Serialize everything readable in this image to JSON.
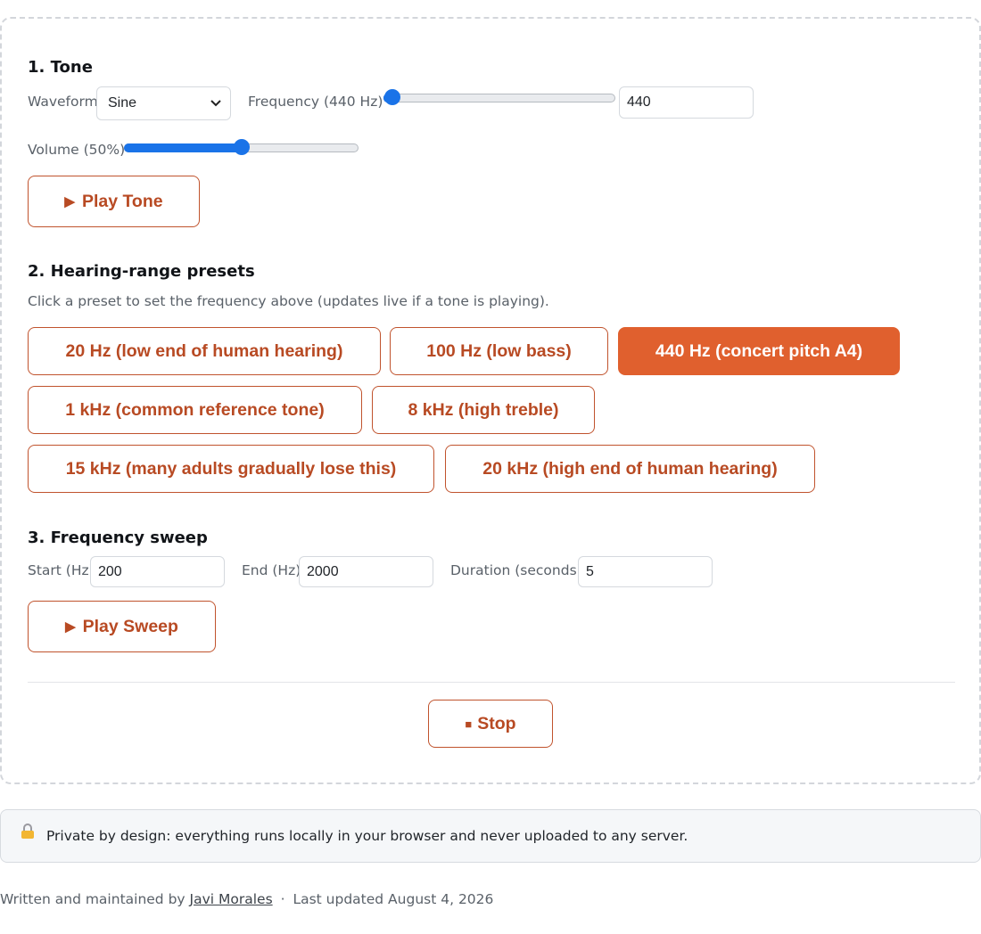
{
  "tone": {
    "heading": "1. Tone",
    "waveform_label": "Waveform",
    "waveform_value": "Sine",
    "frequency_label": "Frequency (440 Hz)",
    "frequency_value": "440",
    "frequency_slider_fraction": 0.02,
    "volume_label": "Volume (50%)",
    "volume_slider_fraction": 0.5,
    "play_label": "Play Tone"
  },
  "presets": {
    "heading": "2. Hearing-range presets",
    "help": "Click a preset to set the frequency above (updates live if a tone is playing).",
    "items": [
      {
        "label": "20 Hz (low end of human hearing)"
      },
      {
        "label": "100 Hz (low bass)"
      },
      {
        "label": "440 Hz (concert pitch A4)",
        "active": true
      },
      {
        "label": "1 kHz (common reference tone)"
      },
      {
        "label": "8 kHz (high treble)"
      },
      {
        "label": "15 kHz (many adults gradually lose this)"
      },
      {
        "label": "20 kHz (high end of human hearing)"
      }
    ]
  },
  "sweep": {
    "heading": "3. Frequency sweep",
    "start_label": "Start (Hz)",
    "start_value": "200",
    "end_label": "End (Hz)",
    "end_value": "2000",
    "duration_label": "Duration (seconds)",
    "duration_value": "5",
    "play_label": "Play Sweep"
  },
  "stop_label": "Stop",
  "notice": {
    "icon": "lock-icon",
    "text": "Private by design: everything runs locally in your browser and never uploaded to any server."
  },
  "footer": {
    "prefix": "Written and maintained by",
    "author": "Javi Morales",
    "separator": "·",
    "updated": "Last updated August 4, 2026"
  },
  "colors": {
    "accent": "#e0602e",
    "accent_text": "#b84a23",
    "slider": "#1a73e8"
  }
}
